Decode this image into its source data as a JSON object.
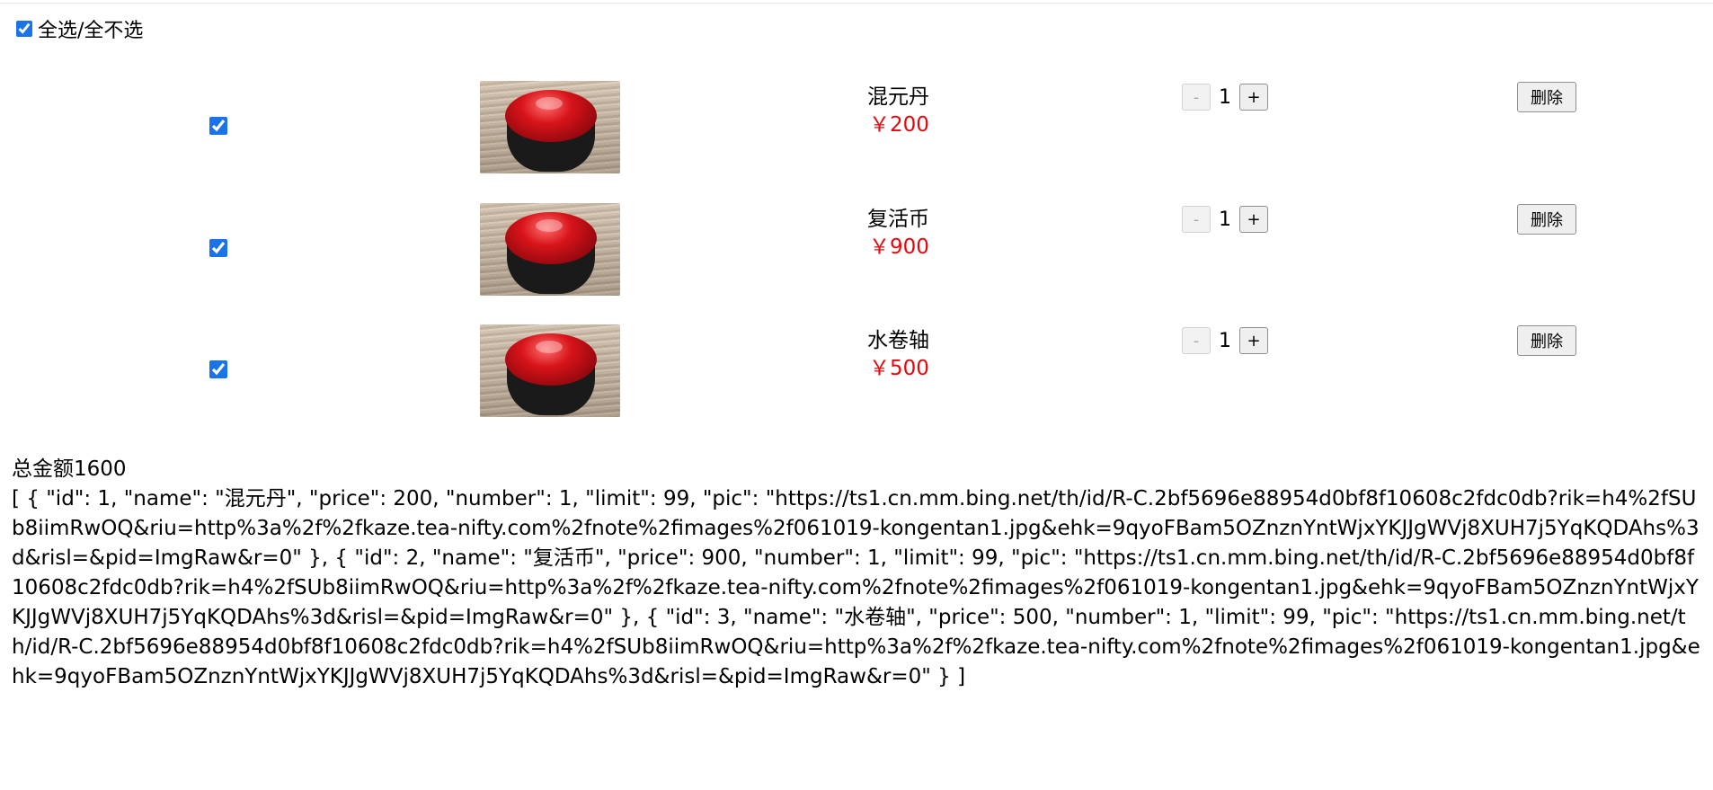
{
  "select_all_label": "全选/全不选",
  "select_all_checked": true,
  "items": [
    {
      "name": "混元丹",
      "price_text": "￥200",
      "number": "1",
      "checked": true,
      "minus_label": "-",
      "plus_label": "+",
      "delete_label": "删除"
    },
    {
      "name": "复活币",
      "price_text": "￥900",
      "number": "1",
      "checked": true,
      "minus_label": "-",
      "plus_label": "+",
      "delete_label": "删除"
    },
    {
      "name": "水卷轴",
      "price_text": "￥500",
      "number": "1",
      "checked": true,
      "minus_label": "-",
      "plus_label": "+",
      "delete_label": "删除"
    }
  ],
  "total_text": "总金额1600",
  "json_dump": "[ { \"id\": 1, \"name\": \"混元丹\", \"price\": 200, \"number\": 1, \"limit\": 99, \"pic\": \"https://ts1.cn.mm.bing.net/th/id/R-C.2bf5696e88954d0bf8f10608c2fdc0db?rik=h4%2fSUb8iimRwOQ&riu=http%3a%2f%2fkaze.tea-nifty.com%2fnote%2fimages%2f061019-kongentan1.jpg&ehk=9qyoFBam5OZnznYntWjxYKJJgWVj8XUH7j5YqKQDAhs%3d&risl=&pid=ImgRaw&r=0\" }, { \"id\": 2, \"name\": \"复活币\", \"price\": 900, \"number\": 1, \"limit\": 99, \"pic\": \"https://ts1.cn.mm.bing.net/th/id/R-C.2bf5696e88954d0bf8f10608c2fdc0db?rik=h4%2fSUb8iimRwOQ&riu=http%3a%2f%2fkaze.tea-nifty.com%2fnote%2fimages%2f061019-kongentan1.jpg&ehk=9qyoFBam5OZnznYntWjxYKJJgWVj8XUH7j5YqKQDAhs%3d&risl=&pid=ImgRaw&r=0\" }, { \"id\": 3, \"name\": \"水卷轴\", \"price\": 500, \"number\": 1, \"limit\": 99, \"pic\": \"https://ts1.cn.mm.bing.net/th/id/R-C.2bf5696e88954d0bf8f10608c2fdc0db?rik=h4%2fSUb8iimRwOQ&riu=http%3a%2f%2fkaze.tea-nifty.com%2fnote%2fimages%2f061019-kongentan1.jpg&ehk=9qyoFBam5OZnznYntWjxYKJJgWVj8XUH7j5YqKQDAhs%3d&risl=&pid=ImgRaw&r=0\" } ]",
  "colors": {
    "price": "#e8070c",
    "checkbox_accent": "#1a73e8"
  }
}
